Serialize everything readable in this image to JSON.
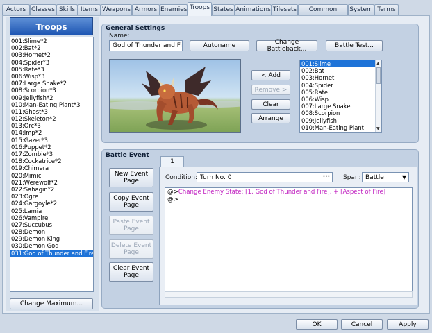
{
  "tabs": [
    "Actors",
    "Classes",
    "Skills",
    "Items",
    "Weapons",
    "Armors",
    "Enemies",
    "Troops",
    "States",
    "Animations",
    "Tilesets",
    "Common Events",
    "System",
    "Terms"
  ],
  "active_tab": "Troops",
  "troops": {
    "header": "Troops",
    "items": [
      "001:Slime*2",
      "002:Bat*2",
      "003:Hornet*2",
      "004:Spider*3",
      "005:Rate*3",
      "006:Wisp*3",
      "007:Large Snake*2",
      "008:Scorpion*3",
      "009:Jellyfish*2",
      "010:Man-Eating Plant*3",
      "011:Ghost*3",
      "012:Skeleton*2",
      "013:Orc*3",
      "014:Imp*2",
      "015:Gazer*3",
      "016:Puppet*2",
      "017:Zombie*3",
      "018:Cockatrice*2",
      "019:Chimera",
      "020:Mimic",
      "021:Werewolf*2",
      "022:Sahagin*2",
      "023:Ogre",
      "024:Gargoyle*2",
      "025:Lamia",
      "026:Vampire",
      "027:Succubus",
      "028:Demon",
      "029:Demon King",
      "030:Demon God",
      "031:God of Thunder and Fire"
    ],
    "selected_index": 30,
    "change_maximum_label": "Change Maximum..."
  },
  "general": {
    "title": "General Settings",
    "name_label": "Name:",
    "name_value": "God of Thunder and Fire",
    "autoname_label": "Autoname",
    "change_battleback_label": "Change Battleback...",
    "battle_test_label": "Battle Test...",
    "add_label": "< Add",
    "remove_label": "Remove >",
    "clear_label": "Clear",
    "arrange_label": "Arrange",
    "members": [
      "001:Slime",
      "002:Bat",
      "003:Hornet",
      "004:Spider",
      "005:Rate",
      "006:Wisp",
      "007:Large Snake",
      "008:Scorpion",
      "009:Jellyfish",
      "010:Man-Eating Plant"
    ],
    "members_selected_index": 0
  },
  "battle_event": {
    "title": "Battle Event",
    "new_page_label": "New Event Page",
    "copy_page_label": "Copy Event Page",
    "paste_page_label": "Paste Event Page",
    "delete_page_label": "Delete Event Page",
    "clear_page_label": "Clear Event Page",
    "page_tab": "1",
    "condition_label": "Condition:",
    "condition_value": "Turn No. 0",
    "span_label": "Span:",
    "span_value": "Battle",
    "commands": [
      {
        "prefix": "@>",
        "text": "Change Enemy State: [1. God of Thunder and Fire], + [Aspect of Fire]"
      },
      {
        "prefix": "@>",
        "text": ""
      }
    ]
  },
  "footer": {
    "ok_label": "OK",
    "cancel_label": "Cancel",
    "apply_label": "Apply"
  },
  "colors": {
    "selection": "#1e73d8",
    "command_text": "#c020c0",
    "header_blue": "#1e56b3"
  }
}
